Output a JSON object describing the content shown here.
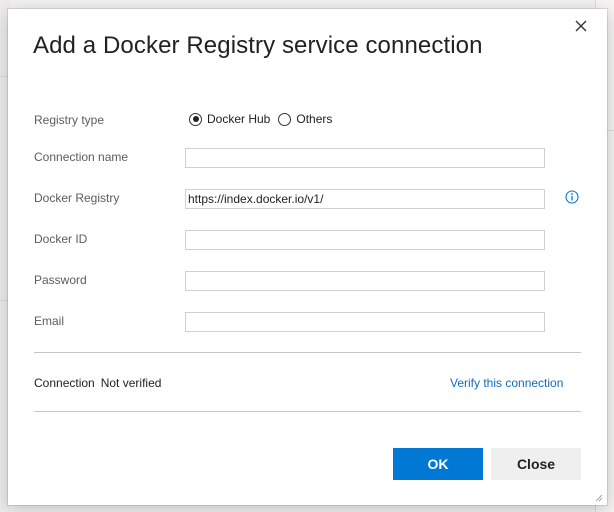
{
  "dialog": {
    "title": "Add a Docker Registry service connection",
    "close_icon": "close-icon"
  },
  "form": {
    "registry_type": {
      "label": "Registry type",
      "options": [
        {
          "label": "Docker Hub",
          "checked": true
        },
        {
          "label": "Others",
          "checked": false
        }
      ]
    },
    "connection_name": {
      "label": "Connection name",
      "value": ""
    },
    "docker_registry": {
      "label": "Docker Registry",
      "value": "https://index.docker.io/v1/",
      "info_icon": "info-icon"
    },
    "docker_id": {
      "label": "Docker ID",
      "value": ""
    },
    "password": {
      "label": "Password",
      "value": ""
    },
    "email": {
      "label": "Email",
      "value": ""
    }
  },
  "connection": {
    "label": "Connection",
    "status": "Not verified",
    "verify_link": "Verify this connection"
  },
  "buttons": {
    "ok": "OK",
    "close": "Close"
  },
  "colors": {
    "primary": "#0078d4",
    "link": "#106ebe",
    "info": "#0078d4"
  }
}
